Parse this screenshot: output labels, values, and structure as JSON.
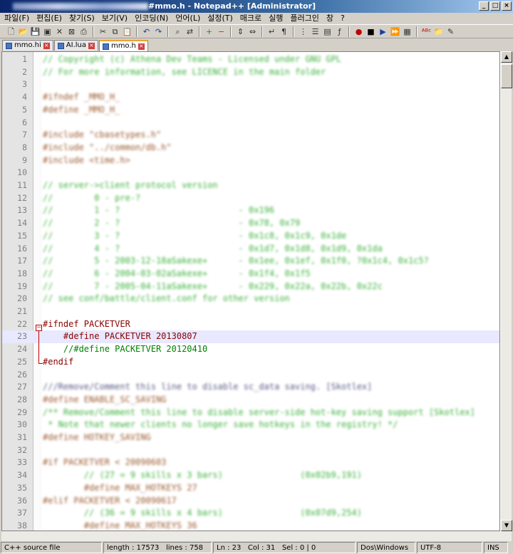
{
  "window": {
    "title": "#mmo.h - Notepad++ [Administrator]",
    "controls": [
      "_",
      "□",
      "×"
    ]
  },
  "menu": [
    "파일(F)",
    "편집(E)",
    "찾기(S)",
    "보기(V)",
    "인코딩(N)",
    "언어(L)",
    "설정(T)",
    "매크로",
    "실행",
    "플러그인",
    "창",
    "?"
  ],
  "toolbar_icons": [
    "new-file-icon",
    "open-file-icon",
    "save-icon",
    "save-all-icon",
    "close-icon",
    "close-all-icon",
    "print-icon",
    "sep",
    "cut-icon",
    "copy-icon",
    "paste-icon",
    "sep",
    "undo-icon",
    "redo-icon",
    "sep",
    "find-icon",
    "replace-icon",
    "sep",
    "zoom-in-icon",
    "zoom-out-icon",
    "sep",
    "sync-v-icon",
    "sync-h-icon",
    "sep",
    "wrap-icon",
    "all-chars-icon",
    "sep",
    "indent-guide-icon",
    "udl-icon",
    "doc-map-icon",
    "function-list-icon",
    "sep",
    "record-icon",
    "stop-icon",
    "play-icon",
    "play-multi-icon",
    "save-macro-icon",
    "sep",
    "spellcheck-icon",
    "folder-icon",
    "highlight-icon"
  ],
  "tabs": [
    {
      "label": "mmo.hi",
      "active": false
    },
    {
      "label": "AI.lua",
      "active": false
    },
    {
      "label": "mmo.h",
      "active": true
    }
  ],
  "lines": [
    {
      "n": "1",
      "text": "// Copyright (c) Athena Dev Teams - Licensed under GNU GPL",
      "style": "blur-green"
    },
    {
      "n": "2",
      "text": "// For more information, see LICENCE in the main folder",
      "style": "blur-green"
    },
    {
      "n": "3",
      "text": "",
      "style": ""
    },
    {
      "n": "4",
      "text": "#ifndef _MMO_H_",
      "style": "blur-brown"
    },
    {
      "n": "5",
      "text": "#define _MMO_H_",
      "style": "blur-brown"
    },
    {
      "n": "6",
      "text": "",
      "style": ""
    },
    {
      "n": "7",
      "text": "#include \"cbasetypes.h\"",
      "style": "blur-brown"
    },
    {
      "n": "8",
      "text": "#include \"../common/db.h\"",
      "style": "blur-brown"
    },
    {
      "n": "9",
      "text": "#include <time.h>",
      "style": "blur-brown"
    },
    {
      "n": "10",
      "text": "",
      "style": ""
    },
    {
      "n": "11",
      "text": "// server->client protocol version",
      "style": "blur-green"
    },
    {
      "n": "12",
      "text": "//        0 - pre-?",
      "style": "blur-green"
    },
    {
      "n": "13",
      "text": "//        1 - ?                       - 0x196",
      "style": "blur-green"
    },
    {
      "n": "14",
      "text": "//        2 - ?                       - 0x78, 0x79",
      "style": "blur-green"
    },
    {
      "n": "15",
      "text": "//        3 - ?                       - 0x1c8, 0x1c9, 0x1de",
      "style": "blur-green"
    },
    {
      "n": "16",
      "text": "//        4 - ?                       - 0x1d7, 0x1d8, 0x1d9, 0x1da",
      "style": "blur-green"
    },
    {
      "n": "17",
      "text": "//        5 - 2003-12-18aSakexe+      - 0x1ee, 0x1ef, 0x1f0, ?0x1c4, 0x1c5?",
      "style": "blur-green"
    },
    {
      "n": "18",
      "text": "//        6 - 2004-03-02aSakexe+      - 0x1f4, 0x1f5",
      "style": "blur-green"
    },
    {
      "n": "19",
      "text": "//        7 - 2005-04-11aSakexe+      - 0x229, 0x22a, 0x22b, 0x22c",
      "style": "blur-green"
    },
    {
      "n": "20",
      "text": "// see conf/battle/client.conf for other version",
      "style": "blur-green"
    },
    {
      "n": "21",
      "text": "",
      "style": ""
    },
    {
      "n": "22",
      "text": "#ifndef PACKETVER",
      "style": "pp"
    },
    {
      "n": "23",
      "text": "    #define PACKETVER 20130807",
      "style": "pp"
    },
    {
      "n": "24",
      "text": "    //#define PACKETVER 20120410",
      "style": "cm"
    },
    {
      "n": "25",
      "text": "#endif",
      "style": "pp"
    },
    {
      "n": "26",
      "text": "",
      "style": ""
    },
    {
      "n": "27",
      "text": "///Remove/Comment this line to disable sc_data saving. [Skotlex]",
      "style": "blur-gray"
    },
    {
      "n": "28",
      "text": "#define ENABLE_SC_SAVING",
      "style": "blur-brown"
    },
    {
      "n": "29",
      "text": "/** Remove/Comment this line to disable server-side hot-key saving support [Skotlex]",
      "style": "blur-green"
    },
    {
      "n": "30",
      "text": " * Note that newer clients no longer save hotkeys in the registry! */",
      "style": "blur-green"
    },
    {
      "n": "31",
      "text": "#define HOTKEY_SAVING",
      "style": "blur-brown"
    },
    {
      "n": "32",
      "text": "",
      "style": ""
    },
    {
      "n": "33",
      "text": "#if PACKETVER < 20090603",
      "style": "blur-brown"
    },
    {
      "n": "34",
      "text": "        // (27 = 9 skills x 3 bars)               (0x02b9,191)",
      "style": "blur-green"
    },
    {
      "n": "35",
      "text": "        #define MAX_HOTKEYS 27",
      "style": "blur-brown"
    },
    {
      "n": "36",
      "text": "#elif PACKETVER < 20090617",
      "style": "blur-brown"
    },
    {
      "n": "37",
      "text": "        // (36 = 9 skills x 4 bars)               (0x07d9,254)",
      "style": "blur-green"
    },
    {
      "n": "38",
      "text": "        #define MAX_HOTKEYS 36",
      "style": "blur-brown"
    }
  ],
  "current_line": "23",
  "status": {
    "type": "C++ source file",
    "length": "length : 17573",
    "lines": "lines : 758",
    "ln": "Ln : 23",
    "col": "Col : 31",
    "sel": "Sel : 0 | 0",
    "eol": "Dos\\Windows",
    "encoding": "UTF-8",
    "mode": "INS"
  }
}
